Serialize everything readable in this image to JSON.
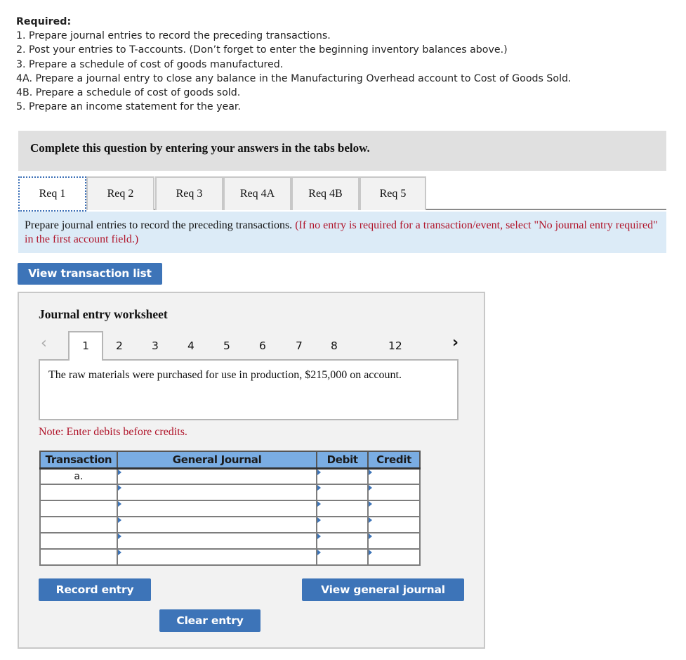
{
  "required": {
    "title": "Required:",
    "items": [
      "1. Prepare journal entries to record the preceding transactions.",
      "2. Post your entries to T-accounts. (Don’t forget to enter the beginning inventory balances above.)",
      "3. Prepare a schedule of cost of goods manufactured.",
      "4A. Prepare a journal entry to close any balance in the Manufacturing Overhead account to Cost of Goods Sold.",
      "4B. Prepare a schedule of cost of goods sold.",
      "5. Prepare an income statement for the year."
    ]
  },
  "banner": {
    "text": "Complete this question by entering your answers in the tabs below."
  },
  "tabs": [
    {
      "label": "Req 1",
      "active": true
    },
    {
      "label": "Req 2",
      "active": false
    },
    {
      "label": "Req 3",
      "active": false
    },
    {
      "label": "Req 4A",
      "active": false
    },
    {
      "label": "Req 4B",
      "active": false
    },
    {
      "label": "Req 5",
      "active": false
    }
  ],
  "instruction": {
    "main": "Prepare journal entries to record the preceding transactions.",
    "note": "(If no entry is required for a transaction/event, select \"No journal entry required\" in the first account field.)"
  },
  "buttons": {
    "view_transaction_list": "View transaction list",
    "record_entry": "Record entry",
    "clear_entry": "Clear entry",
    "view_general_journal": "View general journal"
  },
  "worksheet": {
    "title": "Journal entry worksheet",
    "prev_icon": "chevron-left-icon",
    "next_icon": "chevron-right-icon",
    "pages": [
      "1",
      "2",
      "3",
      "4",
      "5",
      "6",
      "7",
      "8",
      "12"
    ],
    "active_page": "1",
    "description": "The raw materials were purchased for use in production, $215,000 on account.",
    "note": "Note: Enter debits before credits.",
    "columns": [
      "Transaction",
      "General Journal",
      "Debit",
      "Credit"
    ],
    "rows": [
      {
        "transaction": "a.",
        "account": "",
        "debit": "",
        "credit": ""
      },
      {
        "transaction": "",
        "account": "",
        "debit": "",
        "credit": ""
      },
      {
        "transaction": "",
        "account": "",
        "debit": "",
        "credit": ""
      },
      {
        "transaction": "",
        "account": "",
        "debit": "",
        "credit": ""
      },
      {
        "transaction": "",
        "account": "",
        "debit": "",
        "credit": ""
      },
      {
        "transaction": "",
        "account": "",
        "debit": "",
        "credit": ""
      }
    ]
  },
  "colors": {
    "button_blue": "#3d74b8",
    "header_blue": "#7aade3",
    "instruction_bg": "#dcebf7",
    "note_red": "#b0142a"
  }
}
